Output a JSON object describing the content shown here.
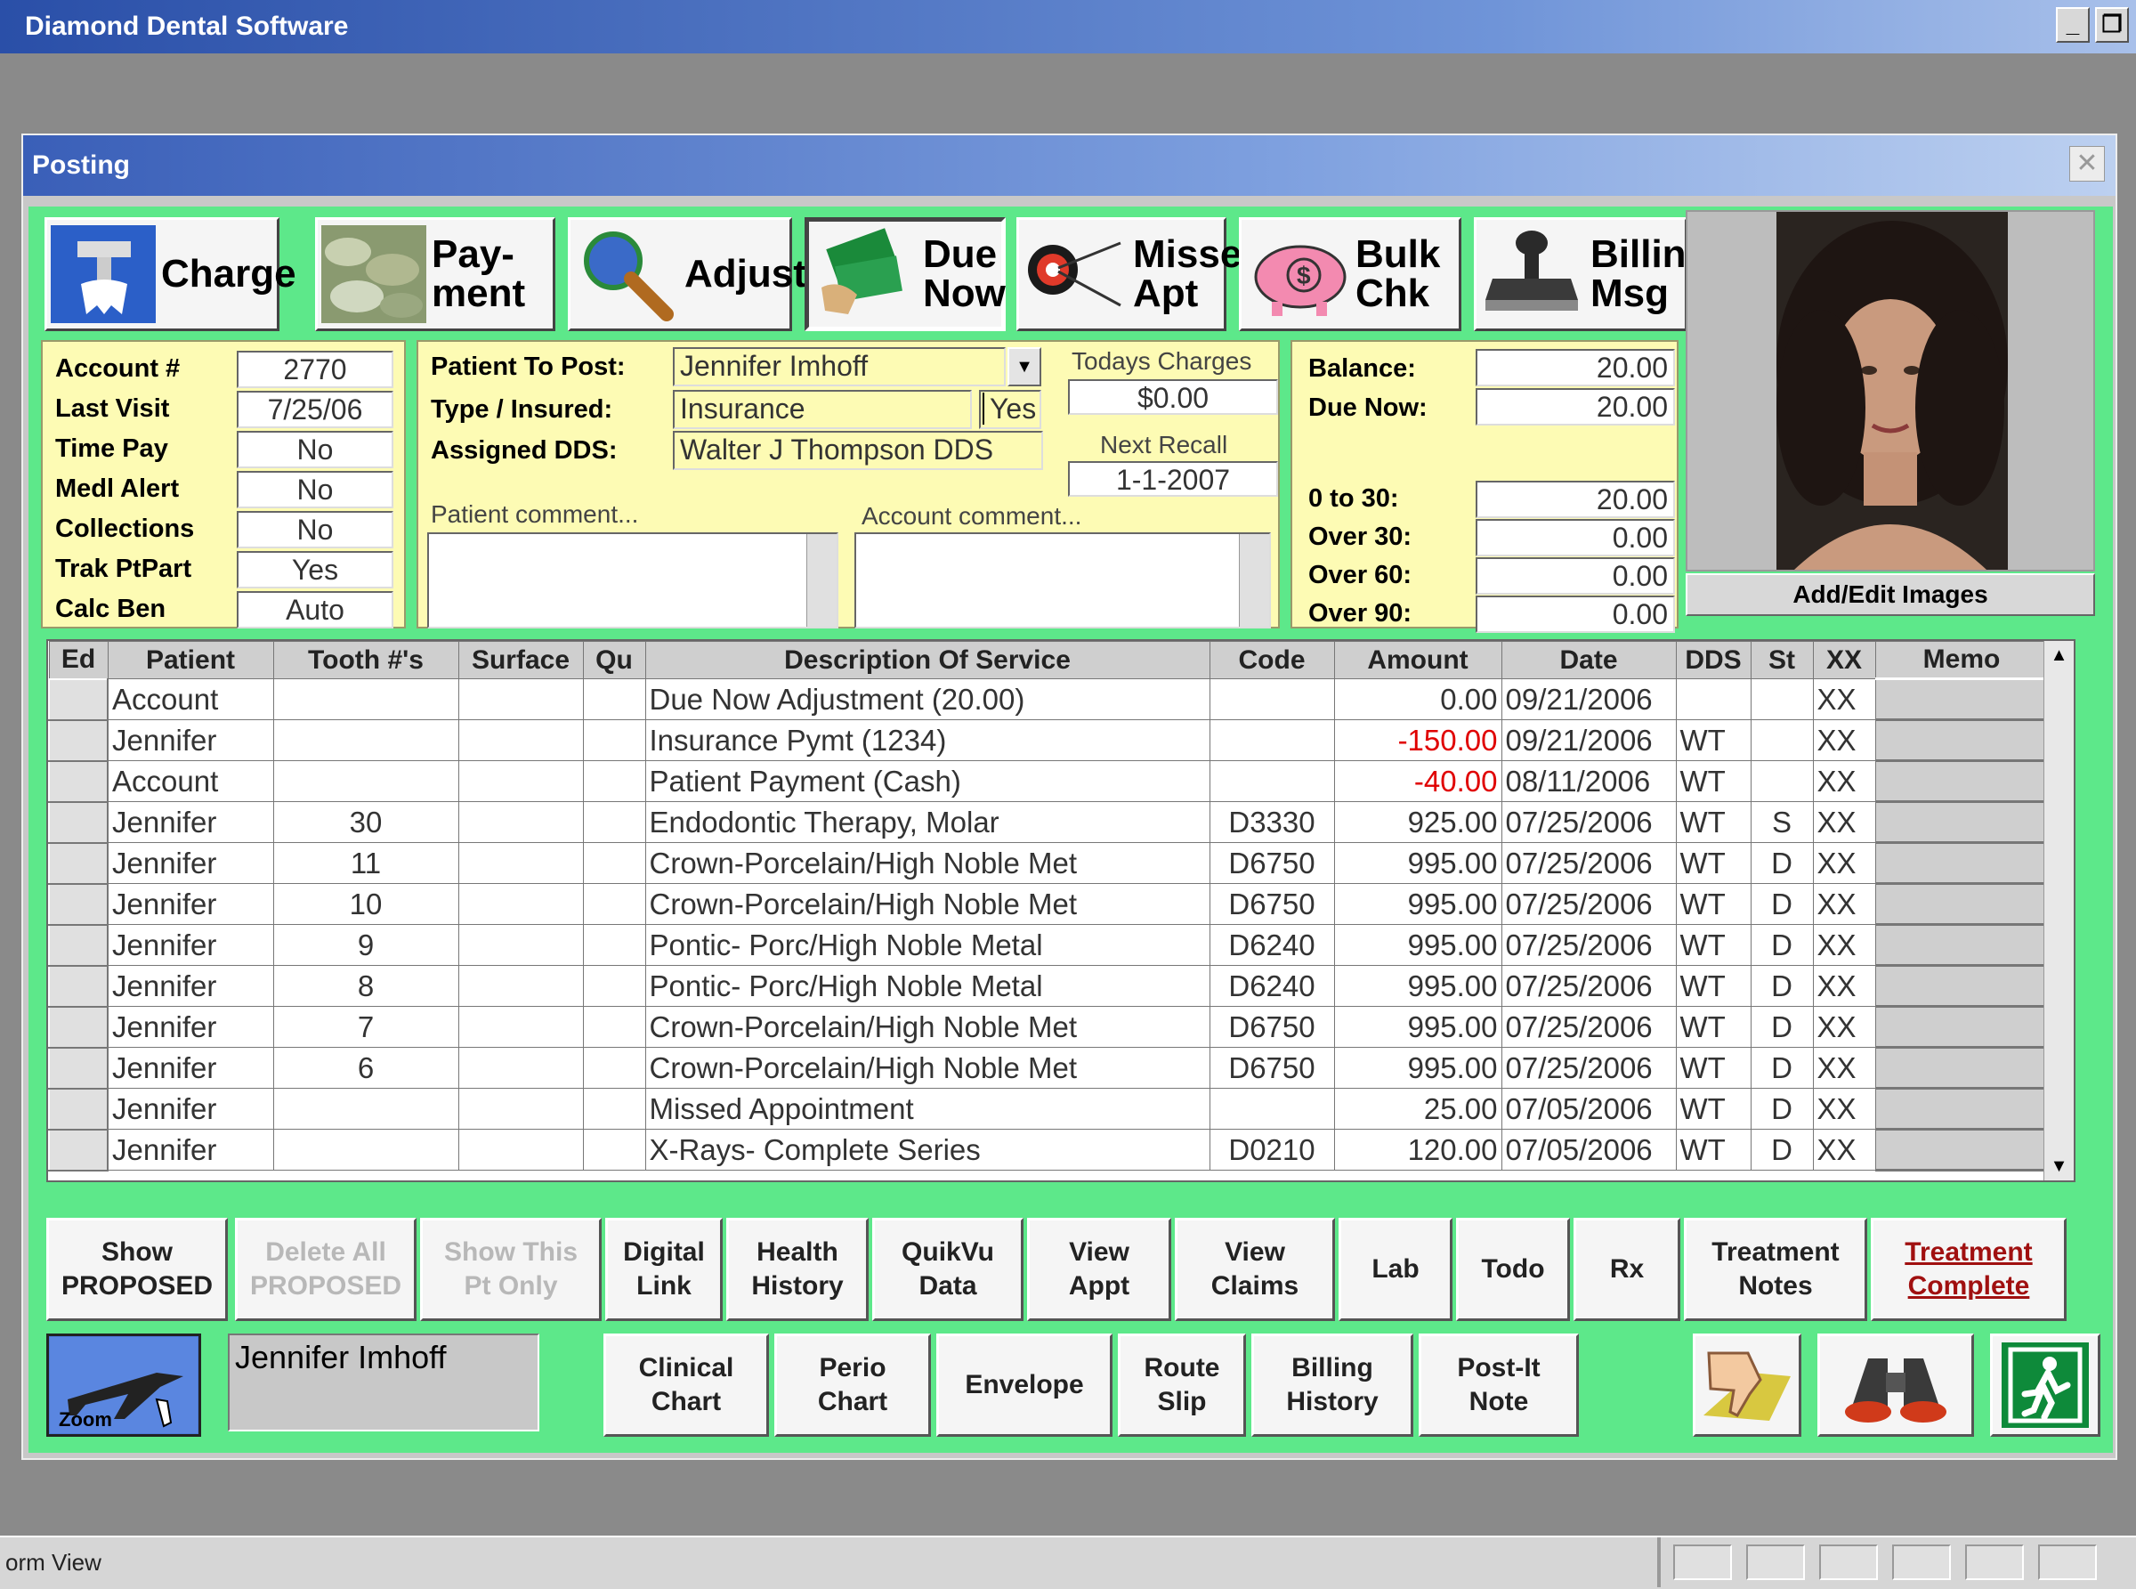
{
  "app": {
    "title": "Diamond Dental Software"
  },
  "window": {
    "title": "Posting",
    "close": "✕"
  },
  "toolbar": [
    {
      "label": "Charge",
      "icon": "charge-icon"
    },
    {
      "label": "Pay-\nment",
      "icon": "money-icon"
    },
    {
      "label": "Adjust",
      "icon": "magnifier-icon"
    },
    {
      "label": "Due\nNow",
      "icon": "cash-icon"
    },
    {
      "label": "Missed\nApt",
      "icon": "target-icon"
    },
    {
      "label": "Bulk\nChk",
      "icon": "piggy-bank-icon"
    },
    {
      "label": "Billing\nMsg",
      "icon": "stamp-icon"
    }
  ],
  "account_panel": [
    {
      "label": "Account #",
      "value": "2770"
    },
    {
      "label": "Last Visit",
      "value": "7/25/06"
    },
    {
      "label": "Time Pay",
      "value": "No"
    },
    {
      "label": "Medl Alert",
      "value": "No"
    },
    {
      "label": "Collections",
      "value": "No"
    },
    {
      "label": "Trak PtPart",
      "value": "Yes"
    },
    {
      "label": "Calc Ben",
      "value": "Auto"
    }
  ],
  "patient_panel": {
    "patient_label": "Patient To Post:",
    "patient_value": "Jennifer  Imhoff",
    "type_label": "Type / Insured:",
    "type_value": "Insurance",
    "insured_value": "Yes",
    "dds_label": "Assigned DDS:",
    "dds_value": "Walter J Thompson DDS",
    "todays_charges_label": "Todays Charges",
    "todays_charges_value": "$0.00",
    "next_recall_label": "Next Recall",
    "next_recall_value": "1-1-2007",
    "patient_comment_label": "Patient comment...",
    "account_comment_label": "Account comment..."
  },
  "balance_panel": {
    "balance_label": "Balance:",
    "balance_value": "20.00",
    "due_label": "Due Now:",
    "due_value": "20.00",
    "aging": [
      {
        "label": "0 to  30:",
        "value": "20.00"
      },
      {
        "label": "Over 30:",
        "value": "0.00"
      },
      {
        "label": "Over 60:",
        "value": "0.00"
      },
      {
        "label": "Over 90:",
        "value": "0.00"
      }
    ]
  },
  "photo": {
    "add_edit_label": "Add/Edit Images"
  },
  "grid": {
    "columns": [
      "Ed",
      "Patient",
      "Tooth #'s",
      "Surface",
      "Qu",
      "Description Of Service",
      "Code",
      "Amount",
      "Date",
      "DDS",
      "St",
      "XX",
      "Memo"
    ],
    "rows": [
      {
        "patient": "Account",
        "tooth": "",
        "desc": "Due Now Adjustment (20.00)",
        "code": "",
        "amount": "0.00",
        "date": "09/21/2006",
        "dds": "",
        "st": "",
        "xx": "XX",
        "neg": false
      },
      {
        "patient": "Jennifer",
        "tooth": "",
        "desc": "Insurance Pymt (1234)",
        "code": "",
        "amount": "-150.00",
        "date": "09/21/2006",
        "dds": "WT",
        "st": "",
        "xx": "XX",
        "neg": true
      },
      {
        "patient": "Account",
        "tooth": "",
        "desc": "Patient Payment (Cash)",
        "code": "",
        "amount": "-40.00",
        "date": "08/11/2006",
        "dds": "WT",
        "st": "",
        "xx": "XX",
        "neg": true
      },
      {
        "patient": "Jennifer",
        "tooth": "30",
        "desc": "Endodontic Therapy, Molar",
        "code": "D3330",
        "amount": "925.00",
        "date": "07/25/2006",
        "dds": "WT",
        "st": "S",
        "xx": "XX",
        "neg": false
      },
      {
        "patient": "Jennifer",
        "tooth": "11",
        "desc": "Crown-Porcelain/High Noble Met",
        "code": "D6750",
        "amount": "995.00",
        "date": "07/25/2006",
        "dds": "WT",
        "st": "D",
        "xx": "XX",
        "neg": false
      },
      {
        "patient": "Jennifer",
        "tooth": "10",
        "desc": "Crown-Porcelain/High Noble Met",
        "code": "D6750",
        "amount": "995.00",
        "date": "07/25/2006",
        "dds": "WT",
        "st": "D",
        "xx": "XX",
        "neg": false
      },
      {
        "patient": "Jennifer",
        "tooth": "9",
        "desc": "Pontic- Porc/High Noble Metal",
        "code": "D6240",
        "amount": "995.00",
        "date": "07/25/2006",
        "dds": "WT",
        "st": "D",
        "xx": "XX",
        "neg": false
      },
      {
        "patient": "Jennifer",
        "tooth": "8",
        "desc": "Pontic- Porc/High Noble Metal",
        "code": "D6240",
        "amount": "995.00",
        "date": "07/25/2006",
        "dds": "WT",
        "st": "D",
        "xx": "XX",
        "neg": false
      },
      {
        "patient": "Jennifer",
        "tooth": "7",
        "desc": "Crown-Porcelain/High Noble Met",
        "code": "D6750",
        "amount": "995.00",
        "date": "07/25/2006",
        "dds": "WT",
        "st": "D",
        "xx": "XX",
        "neg": false
      },
      {
        "patient": "Jennifer",
        "tooth": "6",
        "desc": "Crown-Porcelain/High Noble Met",
        "code": "D6750",
        "amount": "995.00",
        "date": "07/25/2006",
        "dds": "WT",
        "st": "D",
        "xx": "XX",
        "neg": false
      },
      {
        "patient": "Jennifer",
        "tooth": "",
        "desc": "Missed Appointment",
        "code": "",
        "amount": "25.00",
        "date": "07/05/2006",
        "dds": "WT",
        "st": "D",
        "xx": "XX",
        "neg": false
      },
      {
        "patient": "Jennifer",
        "tooth": "",
        "desc": "X-Rays- Complete Series",
        "code": "D0210",
        "amount": "120.00",
        "date": "07/05/2006",
        "dds": "WT",
        "st": "D",
        "xx": "XX",
        "neg": false
      }
    ]
  },
  "bottom_row1": [
    {
      "label": "Show\nPROPOSED",
      "state": "normal"
    },
    {
      "label": "Delete All\nPROPOSED",
      "state": "disabled"
    },
    {
      "label": "Show This\nPt Only",
      "state": "disabled"
    },
    {
      "label": "Digital\nLink",
      "state": "normal"
    },
    {
      "label": "Health\nHistory",
      "state": "normal"
    },
    {
      "label": "QuikVu\nData",
      "state": "normal"
    },
    {
      "label": "View\nAppt",
      "state": "normal"
    },
    {
      "label": "View\nClaims",
      "state": "normal"
    },
    {
      "label": "Lab",
      "state": "normal"
    },
    {
      "label": "Todo",
      "state": "normal"
    },
    {
      "label": "Rx",
      "state": "normal"
    },
    {
      "label": "Treatment\nNotes",
      "state": "normal"
    },
    {
      "label": "Treatment\nComplete",
      "state": "red"
    }
  ],
  "bottom_row2": [
    {
      "label": "Clinical\nChart"
    },
    {
      "label": "Perio\nChart"
    },
    {
      "label": "Envelope"
    },
    {
      "label": "Route\nSlip"
    },
    {
      "label": "Billing\nHistory"
    },
    {
      "label": "Post-It\nNote"
    }
  ],
  "zoom": {
    "label": "Zoom",
    "icon": "jet-icon"
  },
  "current_patient": "Jennifer Imhoff",
  "icons": {
    "thumbs": "thumbs-down-icon",
    "binoculars": "binoculars-icon",
    "exit": "exit-door-icon"
  },
  "statusbar": {
    "text": "orm View"
  },
  "colors": {
    "panel_green": "#5de88a",
    "panel_yellow": "#fdfbb4",
    "negative": "#e00000"
  }
}
